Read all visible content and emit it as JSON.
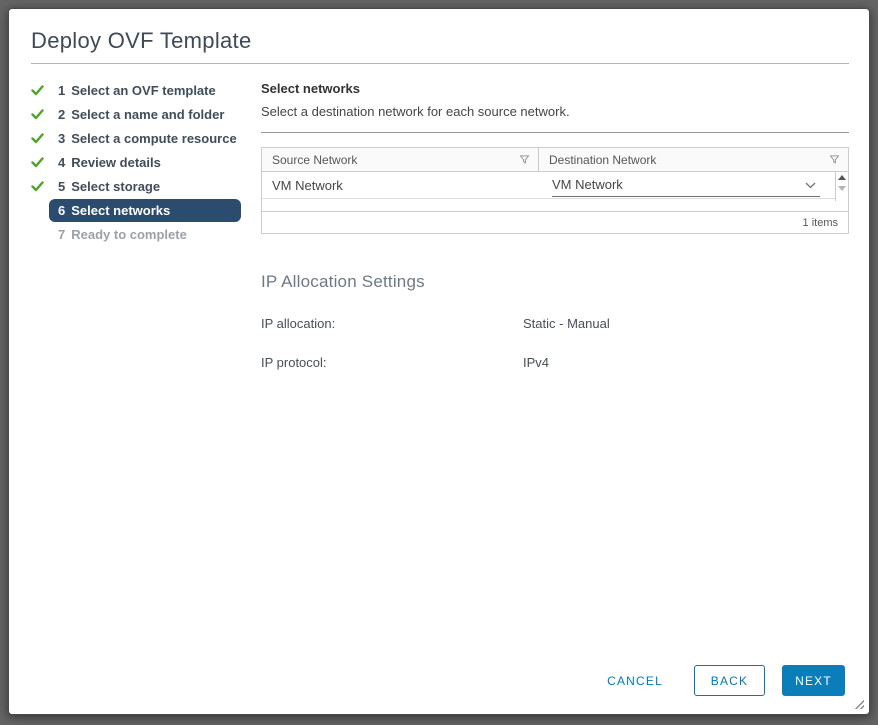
{
  "dialog": {
    "title": "Deploy OVF Template"
  },
  "sidebar": {
    "steps": [
      {
        "number": "1",
        "label": "Select an OVF template",
        "state": "done"
      },
      {
        "number": "2",
        "label": "Select a name and folder",
        "state": "done"
      },
      {
        "number": "3",
        "label": "Select a compute resource",
        "state": "done"
      },
      {
        "number": "4",
        "label": "Review details",
        "state": "done"
      },
      {
        "number": "5",
        "label": "Select storage",
        "state": "done"
      },
      {
        "number": "6",
        "label": "Select networks",
        "state": "current"
      },
      {
        "number": "7",
        "label": "Ready to complete",
        "state": "upcoming"
      }
    ]
  },
  "content": {
    "heading": "Select networks",
    "subheading": "Select a destination network for each source network.",
    "table": {
      "columns": [
        "Source Network",
        "Destination Network"
      ],
      "rows": [
        {
          "source": "VM Network",
          "destination": "VM Network"
        }
      ],
      "footer": "1 items"
    },
    "ip_settings": {
      "heading": "IP Allocation Settings",
      "rows": [
        {
          "label": "IP allocation:",
          "value": "Static - Manual"
        },
        {
          "label": "IP protocol:",
          "value": "IPv4"
        }
      ]
    }
  },
  "footer": {
    "cancel": "CANCEL",
    "back": "BACK",
    "next": "NEXT"
  },
  "icons": {
    "check": "check-icon",
    "filter": "filter-funnel-icon",
    "chevron_down": "chevron-down-icon",
    "scroll_up": "scroll-up-icon",
    "scroll_down": "scroll-down-icon",
    "resize": "resize-handle-icon"
  },
  "colors": {
    "primary_button_blue": "#0b7db8",
    "link_blue": "#0079b8",
    "selected_step_bg": "#2b4b6f",
    "success_green": "#4ea32a",
    "backdrop_gray": "#646464"
  }
}
